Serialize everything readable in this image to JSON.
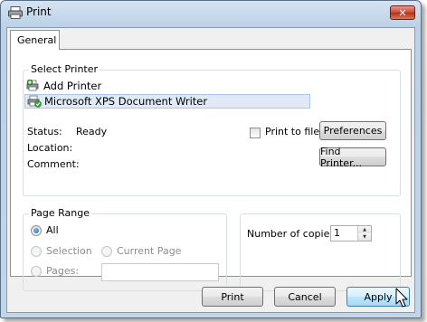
{
  "window": {
    "title": "Print",
    "close_glyph": "✕",
    "icon": "printer-icon"
  },
  "tabs": [
    {
      "label": "General",
      "selected": true
    }
  ],
  "select_printer": {
    "label": "Select Printer",
    "printers": [
      {
        "name": "Add Printer",
        "icon": "add-printer-icon",
        "selected": false
      },
      {
        "name": "Microsoft XPS Document Writer",
        "icon": "printer-default-icon",
        "selected": true
      }
    ],
    "status_label": "Status:",
    "status_value": "Ready",
    "location_label": "Location:",
    "comment_label": "Comment:",
    "print_to_file_label": "Print to file",
    "print_to_file_checked": false,
    "preferences_button": "Preferences",
    "find_printer_button": "Find Printer..."
  },
  "page_range": {
    "label": "Page Range",
    "options": [
      {
        "label": "All",
        "checked": true,
        "enabled": true
      },
      {
        "label": "Selection",
        "checked": false,
        "enabled": false
      },
      {
        "label": "Current Page",
        "checked": false,
        "enabled": false
      },
      {
        "label": "Pages:",
        "checked": false,
        "enabled": false
      }
    ],
    "pages_value": ""
  },
  "copies": {
    "label": "Number of copies:",
    "value": "1"
  },
  "footer": {
    "print_button": "Print",
    "cancel_button": "Cancel",
    "apply_button": "Apply"
  },
  "colors": {
    "accent": "#3c7fb1",
    "selection": "#dfeaf6",
    "close": "#c6452f"
  }
}
